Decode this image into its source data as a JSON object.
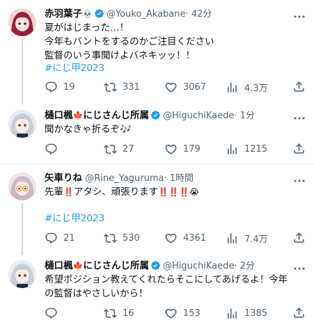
{
  "colors": {
    "accent": "#1d9bf0",
    "secondary_text": "#536471",
    "thread_line": "#cfd9de"
  },
  "tweets": [
    {
      "name": "赤羽葉子",
      "name_emoji": "💀",
      "handle": "@Youko_Akabane",
      "time": "· 42分",
      "lines": [
        "夏がはじまった…！",
        "今年もバントをするのかご注目ください",
        "監督のいう事聞けよバネキッッ！！"
      ],
      "hashtag": "#にじ甲2023",
      "stats": {
        "replies": "19",
        "retweets": "331",
        "likes": "3067",
        "views": "4.3万"
      }
    },
    {
      "name": "樋口楓",
      "name_emoji": "🍁",
      "name_suffix": "にじさんじ所属",
      "handle": "@HiguchiKaede",
      "time": "· 1分",
      "lines": [
        "聞かなきゃ折るぞ🎶"
      ],
      "stats": {
        "replies": "",
        "retweets": "27",
        "likes": "179",
        "views": "1215"
      }
    },
    {
      "name": "矢車りね",
      "handle": "@Rine_Yaguruma",
      "time": "· 1時間",
      "line_prefix": "先輩",
      "line_middle": "アタシ、頑張ります",
      "bang": "‼️",
      "cry": "😭",
      "hashtag": "#にじ甲2023",
      "stats": {
        "replies": "21",
        "retweets": "530",
        "likes": "4361",
        "views": "7.4万"
      }
    },
    {
      "name": "樋口楓",
      "name_emoji": "🍁",
      "name_suffix": "にじさんじ所属",
      "handle": "@HiguchiKaede",
      "time": "· 2分",
      "lines": [
        "希望ポジション教えてくれたらそこにしてあげるよ！今年",
        "の監督はやさしいから！"
      ],
      "stats": {
        "replies": "",
        "retweets": "16",
        "likes": "153",
        "views": "1385"
      }
    }
  ]
}
